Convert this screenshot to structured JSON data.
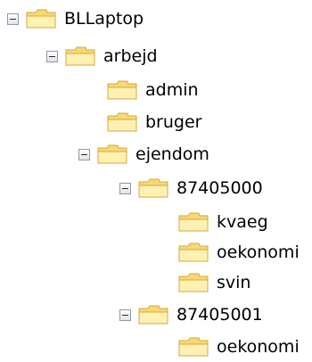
{
  "colors": {
    "folder_fill": "#f5d974",
    "folder_dark": "#d7a93a",
    "folder_light": "#fff1b3",
    "toggle_border": "#8c9aa8"
  },
  "icons": {
    "expand": "minus-box-icon",
    "folder": "open-folder-icon"
  },
  "tree": {
    "nodes": [
      {
        "label": "BLLaptop",
        "expanded": true
      },
      {
        "label": "arbejd",
        "expanded": true
      },
      {
        "label": "admin"
      },
      {
        "label": "bruger"
      },
      {
        "label": "ejendom",
        "expanded": true
      },
      {
        "label": "87405000",
        "expanded": true
      },
      {
        "label": "kvaeg"
      },
      {
        "label": "oekonomi"
      },
      {
        "label": "svin"
      },
      {
        "label": "87405001",
        "expanded": true
      },
      {
        "label": "oekonomi"
      }
    ]
  }
}
